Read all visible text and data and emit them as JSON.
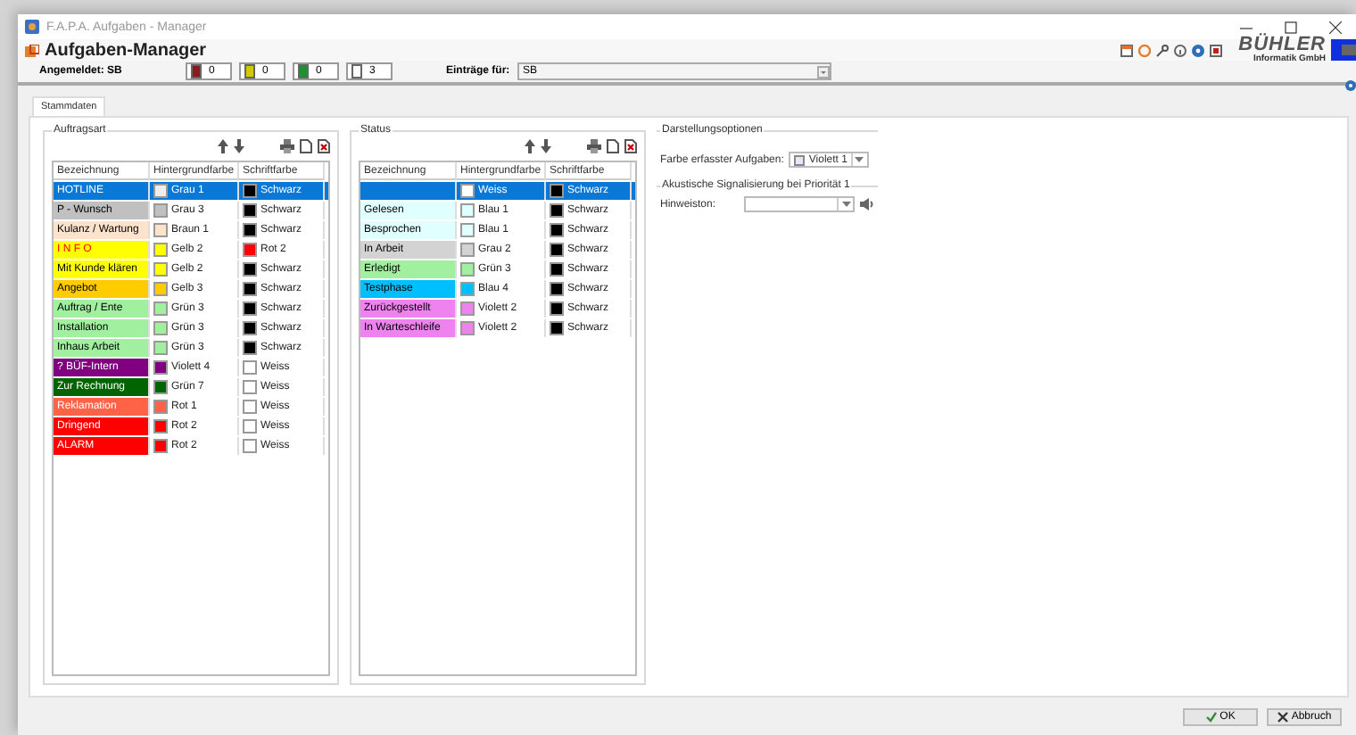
{
  "window": {
    "title": "F.A.P.A. Aufgaben - Manager"
  },
  "header": {
    "title": "Aufgaben-Manager",
    "logo_name": "BÜHLER",
    "logo_subtitle": "Informatik GmbH"
  },
  "toolbar": {
    "user_label": "Angemeldet: SB",
    "counters": [
      {
        "color": "#8b1a1a",
        "count": "0"
      },
      {
        "color": "#d4c800",
        "count": "0"
      },
      {
        "color": "#1f8f2f",
        "count": "0"
      },
      {
        "color": "#ffffff",
        "count": "3"
      }
    ],
    "entries_label": "Einträge für:",
    "entries_value": "SB"
  },
  "tabs": [
    {
      "label": "Stammdaten",
      "selected": true
    }
  ],
  "task_types": {
    "title": "Auftragsart",
    "columns": [
      "Bezeichnung",
      "Hintergrundfarbe",
      "Schriftfarbe"
    ],
    "rows": [
      {
        "name": "HOTLINE",
        "selected": true,
        "background": {
          "name": "Grau 1",
          "color": "#eeeeee"
        },
        "font": {
          "name": "Schwarz",
          "color": "#000000"
        }
      },
      {
        "name": "P - Wunsch",
        "selected": false,
        "background": {
          "name": "Grau 3",
          "color": "#c0c0c0"
        },
        "font": {
          "name": "Schwarz",
          "color": "#000000"
        }
      },
      {
        "name": "Kulanz / Wartung",
        "selected": false,
        "background": {
          "name": "Braun 1",
          "color": "#fde2cc"
        },
        "font": {
          "name": "Schwarz",
          "color": "#000000"
        }
      },
      {
        "name": "I N F O",
        "selected": false,
        "background": {
          "name": "Gelb 2",
          "color": "#ffff00"
        },
        "font": {
          "name": "Rot 2",
          "color": "#ff0000"
        }
      },
      {
        "name": "Mit Kunde klären",
        "selected": false,
        "background": {
          "name": "Gelb 2",
          "color": "#ffff00"
        },
        "font": {
          "name": "Schwarz",
          "color": "#000000"
        }
      },
      {
        "name": "Angebot",
        "selected": false,
        "background": {
          "name": "Gelb 3",
          "color": "#ffcc00"
        },
        "font": {
          "name": "Schwarz",
          "color": "#000000"
        }
      },
      {
        "name": "Auftrag / Ente",
        "selected": false,
        "background": {
          "name": "Grün 3",
          "color": "#a0f0a0"
        },
        "font": {
          "name": "Schwarz",
          "color": "#000000"
        }
      },
      {
        "name": "Installation",
        "selected": false,
        "background": {
          "name": "Grün 3",
          "color": "#a0f0a0"
        },
        "font": {
          "name": "Schwarz",
          "color": "#000000"
        }
      },
      {
        "name": "Inhaus Arbeit",
        "selected": false,
        "background": {
          "name": "Grün 3",
          "color": "#a0f0a0"
        },
        "font": {
          "name": "Schwarz",
          "color": "#000000"
        }
      },
      {
        "name": "? BÜF-Intern",
        "selected": false,
        "background": {
          "name": "Violett 4",
          "color": "#800080"
        },
        "font": {
          "name": "Weiss",
          "color": "#ffffff"
        }
      },
      {
        "name": "Zur Rechnung",
        "selected": false,
        "background": {
          "name": "Grün 7",
          "color": "#006400"
        },
        "font": {
          "name": "Weiss",
          "color": "#ffffff"
        }
      },
      {
        "name": "Reklamation",
        "selected": false,
        "background": {
          "name": "Rot 1",
          "color": "#ff6347"
        },
        "font": {
          "name": "Weiss",
          "color": "#ffffff"
        }
      },
      {
        "name": "Dringend",
        "selected": false,
        "background": {
          "name": "Rot 2",
          "color": "#ff0000"
        },
        "font": {
          "name": "Weiss",
          "color": "#ffffff"
        }
      },
      {
        "name": "ALARM",
        "selected": false,
        "background": {
          "name": "Rot 2",
          "color": "#ff0000"
        },
        "font": {
          "name": "Weiss",
          "color": "#ffffff"
        }
      }
    ]
  },
  "statuses": {
    "title": "Status",
    "columns": [
      "Bezeichnung",
      "Hintergrundfarbe",
      "Schriftfarbe"
    ],
    "rows": [
      {
        "selected": true,
        "background": {
          "name": "Weiss",
          "color": "#ffffff"
        },
        "font": {
          "name": "Schwarz",
          "color": "#000000"
        }
      },
      {
        "name": "Gelesen",
        "selected": false,
        "background": {
          "name": "Blau 1",
          "color": "#e0ffff"
        },
        "font": {
          "name": "Schwarz",
          "color": "#000000"
        }
      },
      {
        "name": "Besprochen",
        "selected": false,
        "background": {
          "name": "Blau 1",
          "color": "#e0ffff"
        },
        "font": {
          "name": "Schwarz",
          "color": "#000000"
        }
      },
      {
        "name": "In Arbeit",
        "selected": false,
        "background": {
          "name": "Grau 2",
          "color": "#d3d3d3"
        },
        "font": {
          "name": "Schwarz",
          "color": "#000000"
        }
      },
      {
        "name": "Erledigt",
        "selected": false,
        "background": {
          "name": "Grün 3",
          "color": "#a0f0a0"
        },
        "font": {
          "name": "Schwarz",
          "color": "#000000"
        }
      },
      {
        "name": "Testphase",
        "selected": false,
        "background": {
          "name": "Blau 4",
          "color": "#00bfff"
        },
        "font": {
          "name": "Schwarz",
          "color": "#000000"
        }
      },
      {
        "name": "Zurückgestellt",
        "selected": false,
        "background": {
          "name": "Violett 2",
          "color": "#ee82ee"
        },
        "font": {
          "name": "Schwarz",
          "color": "#000000"
        }
      },
      {
        "name": "In Warteschleife",
        "selected": false,
        "background": {
          "name": "Violett 2",
          "color": "#ee82ee"
        },
        "font": {
          "name": "Schwarz",
          "color": "#000000"
        }
      }
    ]
  },
  "display_options": {
    "title": "Darstellungsoptionen",
    "task_color_label": "Farbe erfasster Aufgaben:",
    "task_color": {
      "name": "Violett 1",
      "color": "#e6e6fa"
    }
  },
  "sound": {
    "title": "Akustische Signalisierung bei Priorität 1",
    "tone_label": "Hinweiston:"
  },
  "buttons": [
    {
      "kind": "ok",
      "label": "OK"
    },
    {
      "kind": "cancel",
      "label": "Abbruch"
    }
  ]
}
